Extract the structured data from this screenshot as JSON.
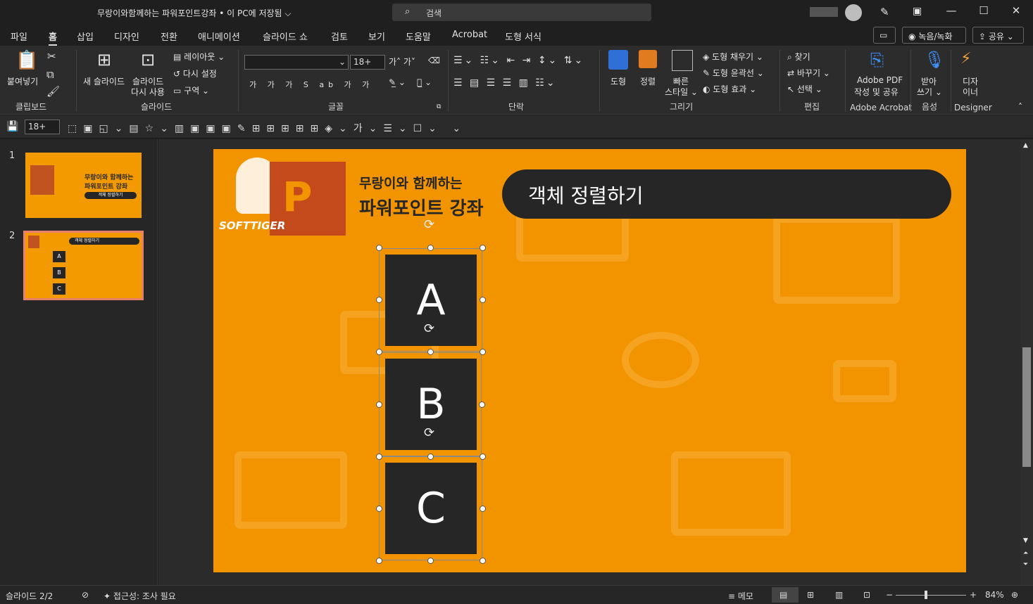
{
  "titlebar": {
    "title": "무랑이와함께하는 파워포인트강좌 • 이 PC에 저장됨 ⌵",
    "search_placeholder": "검색",
    "minimize": "—",
    "maximize": "☐",
    "close": "✕"
  },
  "tabs": [
    {
      "label": "파일",
      "active": false
    },
    {
      "label": "홈",
      "active": true
    },
    {
      "label": "삽입",
      "active": false
    },
    {
      "label": "디자인",
      "active": false
    },
    {
      "label": "전환",
      "active": false
    },
    {
      "label": "애니메이션",
      "active": false
    },
    {
      "label": "슬라이드 쇼",
      "active": false
    },
    {
      "label": "검토",
      "active": false
    },
    {
      "label": "보기",
      "active": false
    },
    {
      "label": "도움말",
      "active": false
    },
    {
      "label": "Acrobat",
      "active": false
    },
    {
      "label": "도형 서식",
      "active": false
    }
  ],
  "top_buttons": {
    "record": "◉ 녹음/녹화",
    "share": "⇪ 공유 ⌄"
  },
  "ribbon": {
    "clipboard": {
      "paste": "붙여넣기",
      "label": "클립보드"
    },
    "slides": {
      "new_slide": "새 슬라이드",
      "reuse_1": "슬라이드",
      "reuse_2": "다시 사용",
      "layout": "레이아웃 ⌄",
      "reset": "다시 설정",
      "section": "구역 ⌄",
      "label": "슬라이드"
    },
    "font": {
      "font_size": "18+",
      "label": "글꼴"
    },
    "paragraph": {
      "label": "단락"
    },
    "drawing": {
      "shape": "도형",
      "arrange": "정렬",
      "quick_style_1": "빠른",
      "quick_style_2": "스타일 ⌄",
      "fill": "도형 채우기 ⌄",
      "outline": "도형 윤곽선 ⌄",
      "effect": "도형 효과 ⌄",
      "label": "그리기"
    },
    "editing": {
      "find": "찾기",
      "replace": "바꾸기 ⌄",
      "select": "선택 ⌄",
      "label": "편집"
    },
    "acrobat": {
      "line1": "Adobe PDF",
      "line2": "작성 및 공유",
      "label": "Adobe Acrobat"
    },
    "voice": {
      "line1": "받아",
      "line2": "쓰기 ⌄",
      "label": "음성"
    },
    "designer": {
      "line1": "디자",
      "line2": "이너",
      "label": "Designer"
    }
  },
  "qat": {
    "font_size": "18+"
  },
  "thumbnails": [
    {
      "number": "1",
      "title": "무랑이와 함께하는 파워포인트 강좌",
      "subtitle": "객체 정렬하기"
    },
    {
      "number": "2",
      "pill": "객체 정렬하기",
      "boxes": [
        "A",
        "B",
        "C"
      ]
    }
  ],
  "slide": {
    "logo_line1": "무랑이와 함께하는",
    "logo_line2": "파워포인트 강좌",
    "brand": "SOFTTIGER",
    "heading": "객체 정렬하기",
    "boxes": [
      "A",
      "B",
      "C"
    ]
  },
  "status": {
    "slide_counter": "슬라이드 2/2",
    "accessibility": "접근성: 조사 필요",
    "notes": "≡ 메모",
    "zoom": "84%"
  },
  "colors": {
    "slide_bg": "#f29400",
    "dark_box": "#262626",
    "accent_orange": "#f39a00"
  }
}
